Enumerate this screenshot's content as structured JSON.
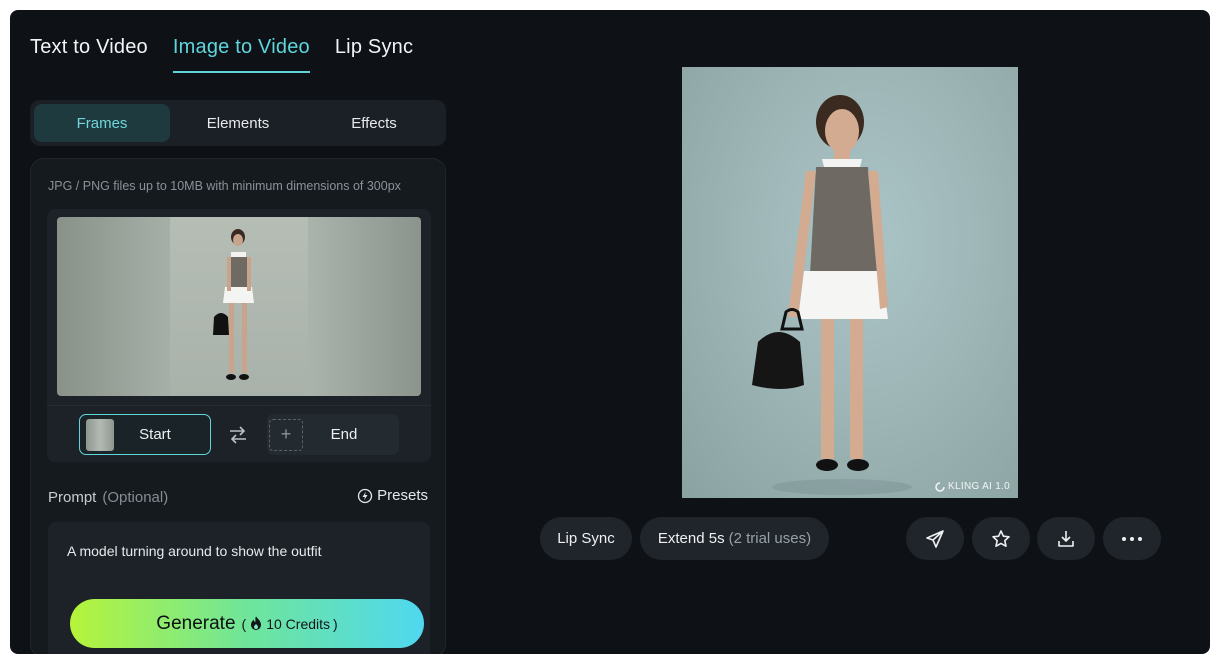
{
  "top_tabs": [
    {
      "label": "Text to Video",
      "active": false
    },
    {
      "label": "Image to Video",
      "active": true
    },
    {
      "label": "Lip Sync",
      "active": false
    }
  ],
  "sub_tabs": [
    {
      "label": "Frames",
      "active": true
    },
    {
      "label": "Elements",
      "active": false
    },
    {
      "label": "Effects",
      "active": false
    }
  ],
  "upload": {
    "hint": "JPG / PNG files up to 10MB with minimum dimensions of 300px",
    "start_label": "Start",
    "end_label": "End"
  },
  "prompt": {
    "label": "Prompt",
    "optional": "(Optional)",
    "presets_label": "Presets",
    "text": "A model turning around to show the outfit"
  },
  "generate": {
    "label": "Generate",
    "credits": "10 Credits"
  },
  "preview": {
    "watermark": "KLING AI 1.0"
  },
  "actions": {
    "lip_sync": "Lip Sync",
    "extend": "Extend 5s",
    "extend_note": "(2 trial uses)"
  },
  "colors": {
    "accent": "#5fd5dc",
    "background": "#0e1216",
    "panel": "#151a1f"
  }
}
